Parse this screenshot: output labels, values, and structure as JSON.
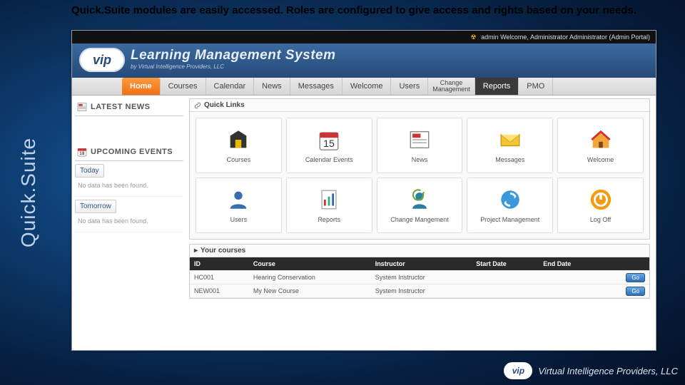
{
  "slide": {
    "title": "Quick.Suite modules are easily accessed. Roles are configured to give access and rights based on your needs.",
    "sidebar_label": "Quick.Suite"
  },
  "topbar": {
    "icon": "☢",
    "text": "admin Welcome, Administrator Administrator (Admin Portal)"
  },
  "brand": {
    "logo": "vip",
    "title": "Learning Management System",
    "subtitle": "by Virtual Intelligence Providers, LLC"
  },
  "nav": [
    {
      "label": "Home",
      "active": true
    },
    {
      "label": "Courses"
    },
    {
      "label": "Calendar"
    },
    {
      "label": "News"
    },
    {
      "label": "Messages"
    },
    {
      "label": "Welcome"
    },
    {
      "label": "Users"
    },
    {
      "label": "Change\nManagement",
      "small": true
    },
    {
      "label": "Reports",
      "alt": true
    },
    {
      "label": "PMO"
    }
  ],
  "left": {
    "latest_news": "LATEST NEWS",
    "upcoming_events": "UPCOMING EVENTS",
    "today": "Today",
    "tomorrow": "Tomorrow",
    "no_data": "No data has been found."
  },
  "quick_links": {
    "title": "Quick Links",
    "items": [
      {
        "label": "Courses",
        "icon": "courses"
      },
      {
        "label": "Calendar Events",
        "icon": "calendar"
      },
      {
        "label": "News",
        "icon": "news"
      },
      {
        "label": "Messages",
        "icon": "messages"
      },
      {
        "label": "Welcome",
        "icon": "welcome"
      },
      {
        "label": "Users",
        "icon": "users"
      },
      {
        "label": "Reports",
        "icon": "reports"
      },
      {
        "label": "Change Mangement",
        "icon": "change"
      },
      {
        "label": "Project Management",
        "icon": "project"
      },
      {
        "label": "Log Off",
        "icon": "logoff"
      }
    ]
  },
  "your_courses": {
    "title": "Your courses",
    "cols": [
      "ID",
      "Course",
      "Instructor",
      "Start Date",
      "End Date"
    ],
    "rows": [
      {
        "id": "HC001",
        "course": "Hearing Conservation",
        "instructor": "System Instructor",
        "start": "",
        "end": "",
        "go": "Go"
      },
      {
        "id": "NEW001",
        "course": "My New Course",
        "instructor": "System Instructor",
        "start": "",
        "end": "",
        "go": "Go"
      }
    ]
  },
  "footer": {
    "logo": "vip",
    "text": "Virtual Intelligence Providers, LLC"
  }
}
